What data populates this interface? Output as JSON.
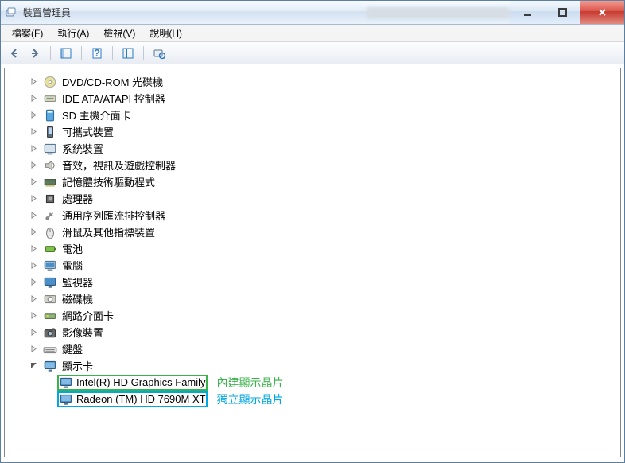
{
  "window": {
    "title": "裝置管理員"
  },
  "menu": {
    "file": "檔案(F)",
    "action": "執行(A)",
    "view": "檢視(V)",
    "help": "說明(H)"
  },
  "categories": [
    {
      "icon": "disc",
      "label": "DVD/CD-ROM 光碟機",
      "expanded": false
    },
    {
      "icon": "ide",
      "label": "IDE ATA/ATAPI 控制器",
      "expanded": false
    },
    {
      "icon": "sd",
      "label": "SD 主機介面卡",
      "expanded": false
    },
    {
      "icon": "portable",
      "label": "可攜式裝置",
      "expanded": false
    },
    {
      "icon": "system",
      "label": "系統裝置",
      "expanded": false
    },
    {
      "icon": "sound",
      "label": "音效，視訊及遊戲控制器",
      "expanded": false
    },
    {
      "icon": "memory",
      "label": "記憶體技術驅動程式",
      "expanded": false
    },
    {
      "icon": "cpu",
      "label": "處理器",
      "expanded": false
    },
    {
      "icon": "usb",
      "label": "通用序列匯流排控制器",
      "expanded": false
    },
    {
      "icon": "mouse",
      "label": "滑鼠及其他指標裝置",
      "expanded": false
    },
    {
      "icon": "battery",
      "label": "電池",
      "expanded": false
    },
    {
      "icon": "computer",
      "label": "電腦",
      "expanded": false
    },
    {
      "icon": "monitor",
      "label": "監視器",
      "expanded": false
    },
    {
      "icon": "disk",
      "label": "磁碟機",
      "expanded": false
    },
    {
      "icon": "network",
      "label": "網路介面卡",
      "expanded": false
    },
    {
      "icon": "imaging",
      "label": "影像裝置",
      "expanded": false
    },
    {
      "icon": "keyboard",
      "label": "鍵盤",
      "expanded": false
    },
    {
      "icon": "display",
      "label": "顯示卡",
      "expanded": true
    }
  ],
  "display_children": [
    {
      "label": "Intel(R) HD Graphics Family",
      "annotation": "內建顯示晶片",
      "highlight": "green"
    },
    {
      "label": "Radeon (TM) HD 7690M XT",
      "annotation": "獨立顯示晶片",
      "highlight": "blue"
    }
  ]
}
